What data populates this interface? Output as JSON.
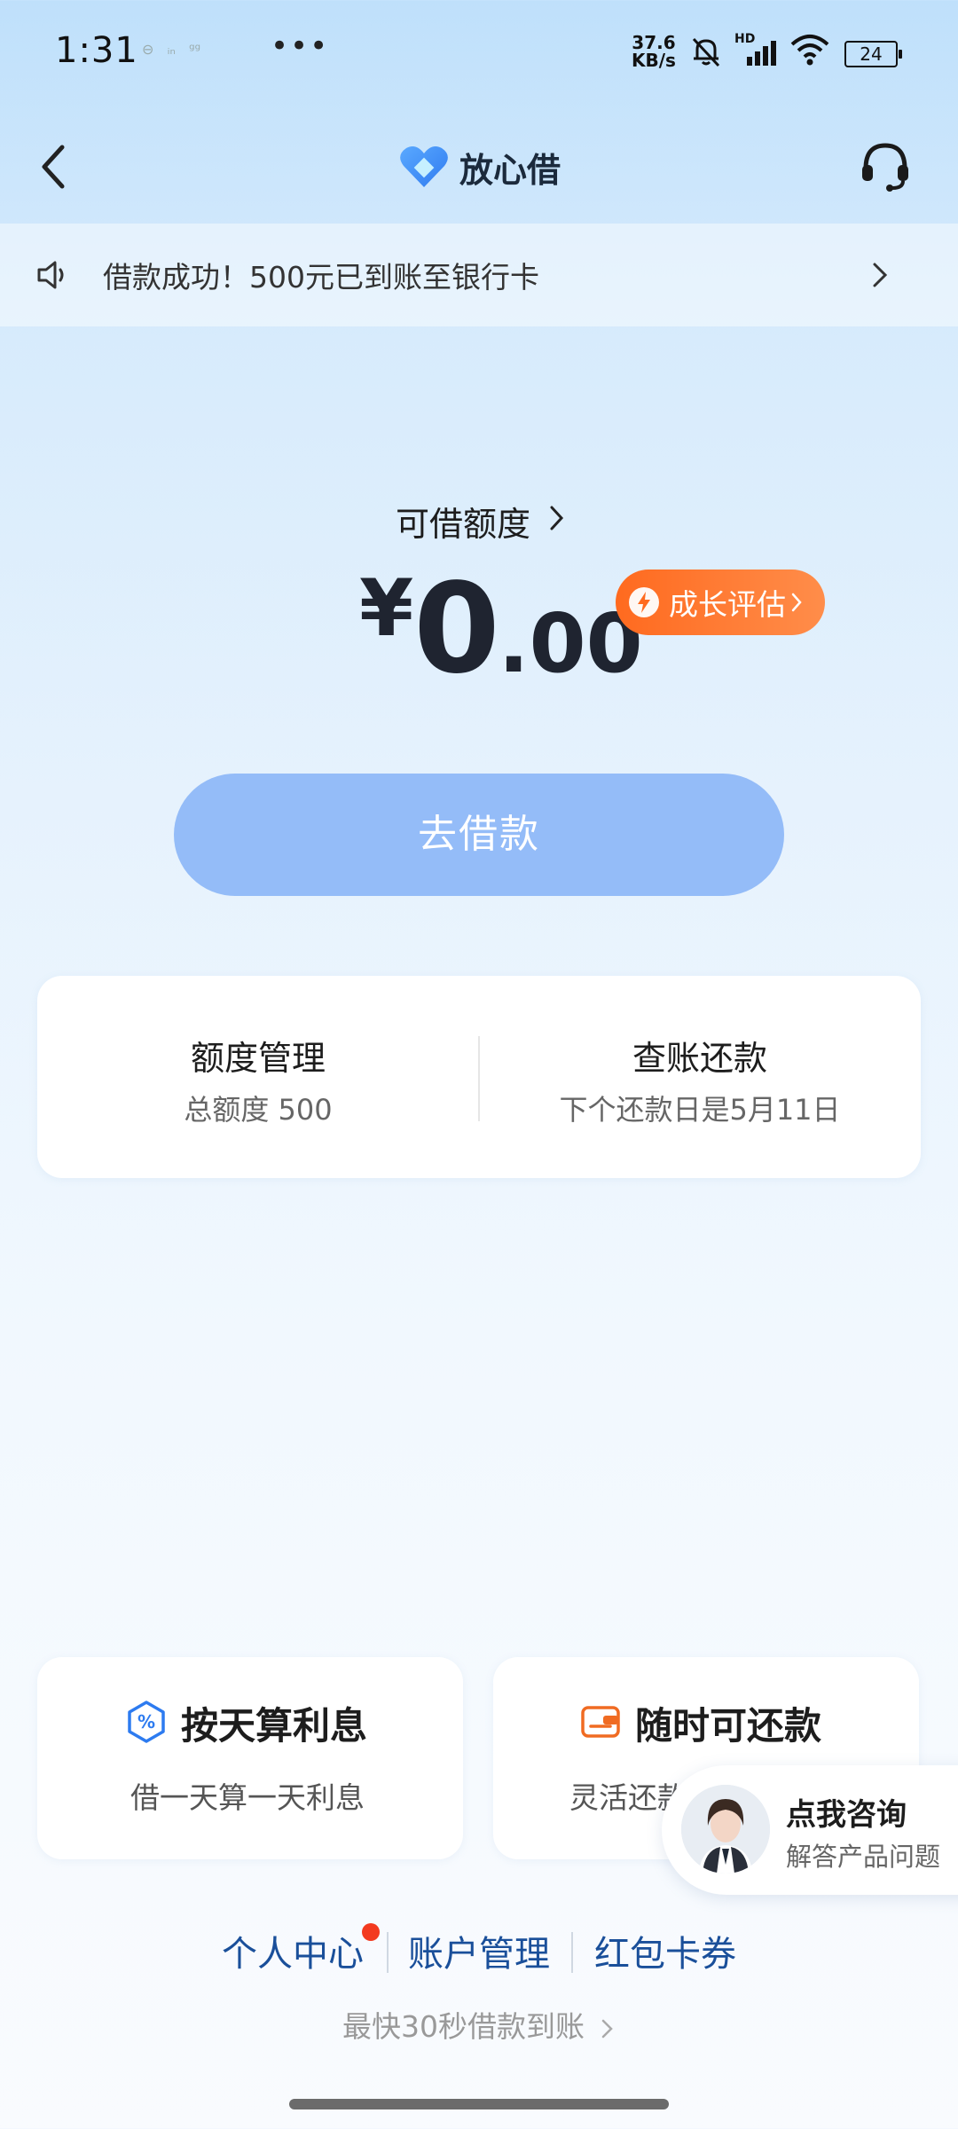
{
  "status_bar": {
    "time": "1:31",
    "net_speed_value": "37.6",
    "net_speed_unit": "KB/s",
    "network_label": "HD",
    "battery": "24"
  },
  "header": {
    "app_title": "放心借",
    "brand_color": "#3b8cf5"
  },
  "notice": {
    "text": "借款成功！500元已到账至银行卡"
  },
  "credit": {
    "label": "可借额度",
    "currency": "¥",
    "amount_int": "0",
    "amount_dec": ".00",
    "growth_label": "成长评估",
    "cta_label": "去借款"
  },
  "manage": {
    "left_title": "额度管理",
    "left_sub": "总额度 500",
    "right_title": "查账还款",
    "right_sub": "下个还款日是5月11日"
  },
  "features": [
    {
      "title": "按天算利息",
      "sub": "借一天算一天利息",
      "icon": "percent-icon"
    },
    {
      "title": "随时可还款",
      "sub": "灵活还款",
      "icon": "wallet-icon"
    }
  ],
  "consult": {
    "title": "点我咨询",
    "sub": "解答产品问题"
  },
  "bottom_links": [
    "个人中心",
    "账户管理",
    "红包卡券"
  ],
  "footer_tip": "最快30秒借款到账",
  "colors": {
    "accent_orange": "#ff6a1f",
    "cta_blue": "#94bcf8",
    "link_blue": "#1a4f9a",
    "badge_red": "#f33a1f"
  }
}
